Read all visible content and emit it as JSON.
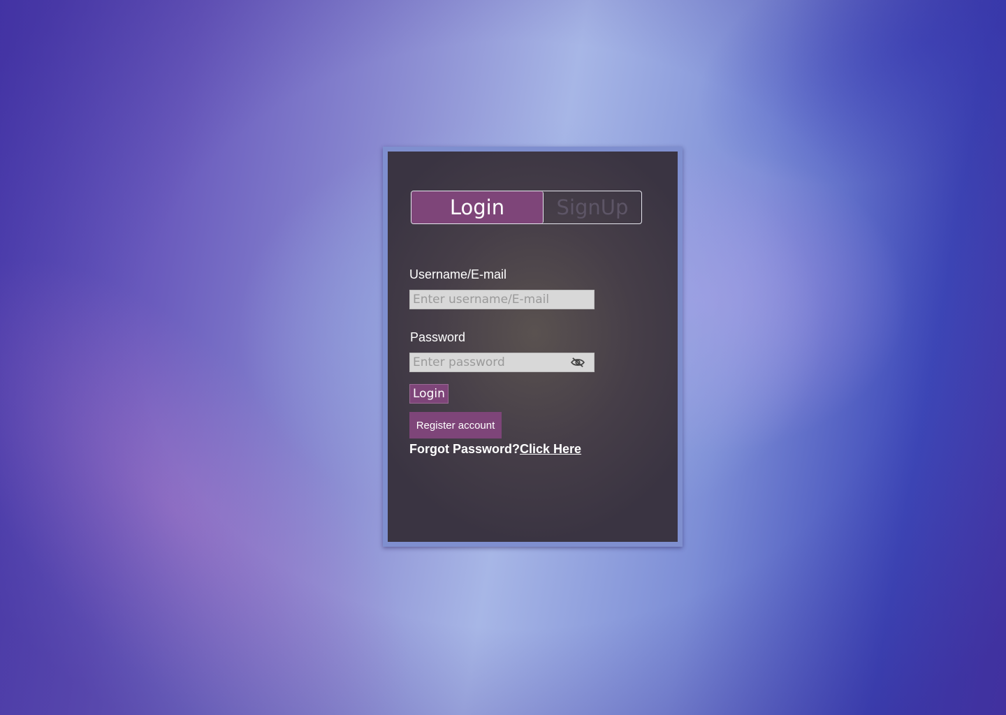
{
  "tabs": {
    "login_label": "Login",
    "signup_label": "SignUp"
  },
  "form": {
    "username_label": "Username/E-mail",
    "username_placeholder": "Enter username/E-mail",
    "username_value": "",
    "password_label": "Password",
    "password_placeholder": "Enter password",
    "password_value": "",
    "password_toggle_icon": "eye-slash-icon",
    "login_button_label": "Login",
    "register_button_label": "Register account",
    "forgot_text": "Forgot Password?",
    "forgot_link_label": "Click Here"
  },
  "colors": {
    "accent": "#7e4579",
    "card_background": "#463e4a",
    "card_border": "#7f8fcf",
    "input_background": "#d8d8d8"
  }
}
